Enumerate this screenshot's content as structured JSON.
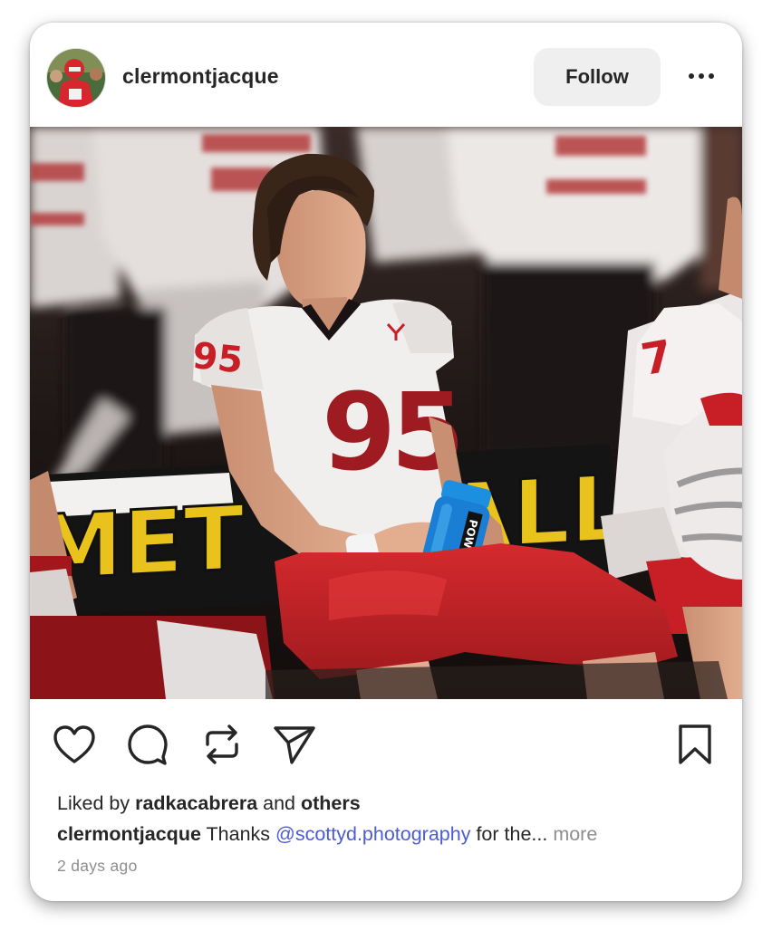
{
  "post": {
    "username": "clermontjacque",
    "follow_label": "Follow",
    "more_options": "more-horizontal-icon",
    "photo": {
      "jersey_number": "95",
      "teammate_jersey_number": "7",
      "bottle_label": "POWERADE",
      "banner_left_text": "MET",
      "banner_right_text": "ALL",
      "sound_state": "muted"
    },
    "actions": {
      "like": "heart-icon",
      "comment": "comment-icon",
      "repost": "repost-icon",
      "share": "send-icon",
      "save": "bookmark-icon"
    },
    "likes": {
      "prefix": "Liked by",
      "user": "radkacabrera",
      "joiner": "and",
      "others": "others"
    },
    "caption": {
      "username": "clermontjacque",
      "text_before": "Thanks",
      "mention": "@scottyd.photography",
      "text_after": "for the...",
      "more_label": "more"
    },
    "timestamp": "2 days ago"
  },
  "colors": {
    "mention": "#4c5bd4",
    "follow_bg": "#efefef",
    "jersey_red": "#c81e26",
    "banner_yellow": "#e9c31c"
  }
}
